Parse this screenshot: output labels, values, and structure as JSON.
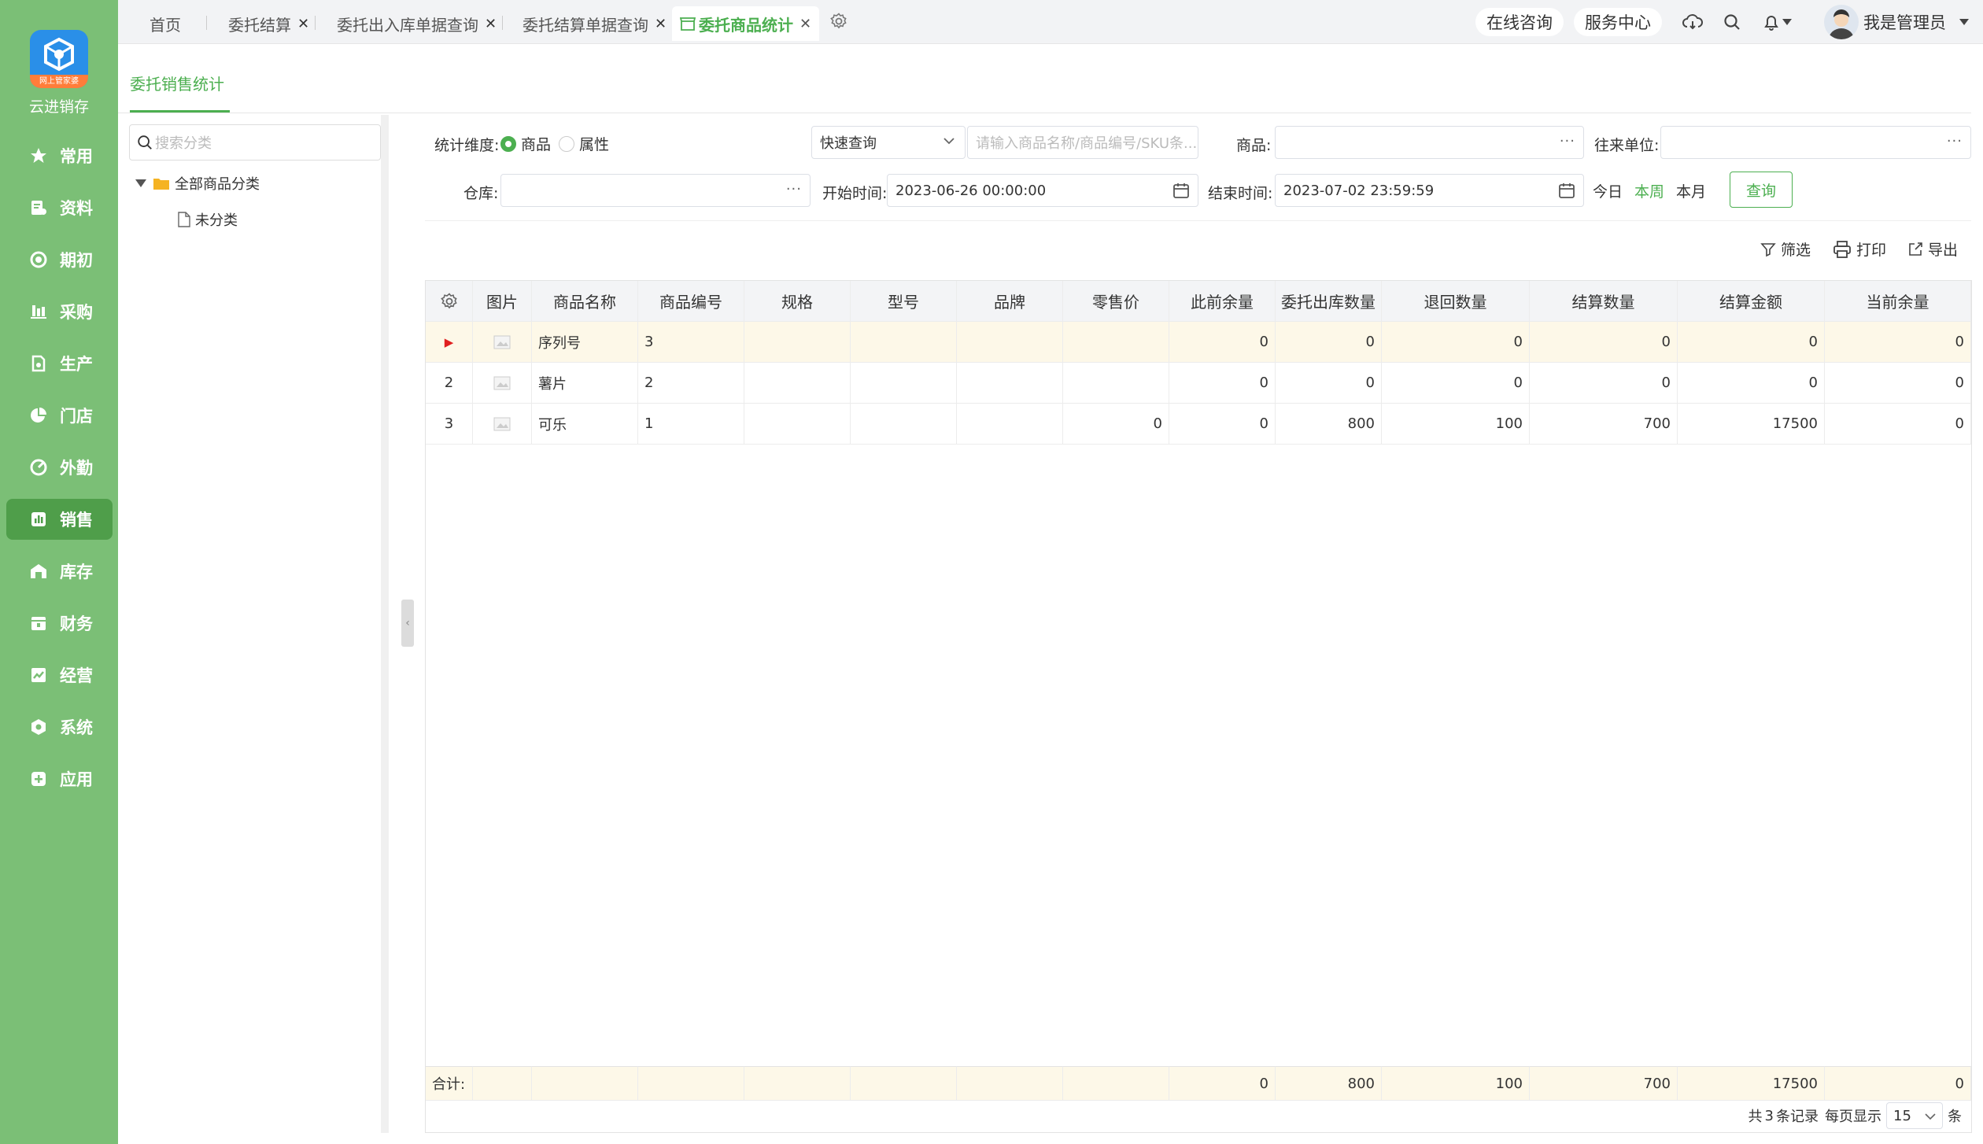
{
  "app": {
    "name": "云进销存",
    "logo_caption": "网上管家婆"
  },
  "sidebar": {
    "items": [
      {
        "label": "常用",
        "icon": "star-icon"
      },
      {
        "label": "资料",
        "icon": "profile-icon"
      },
      {
        "label": "期初",
        "icon": "target-icon"
      },
      {
        "label": "采购",
        "icon": "purchase-icon"
      },
      {
        "label": "生产",
        "icon": "production-icon"
      },
      {
        "label": "门店",
        "icon": "pie-icon"
      },
      {
        "label": "外勤",
        "icon": "field-icon"
      },
      {
        "label": "销售",
        "icon": "bar-chart-icon",
        "active": true
      },
      {
        "label": "库存",
        "icon": "warehouse-icon"
      },
      {
        "label": "财务",
        "icon": "finance-icon"
      },
      {
        "label": "经营",
        "icon": "operation-icon"
      },
      {
        "label": "系统",
        "icon": "hexagon-icon"
      },
      {
        "label": "应用",
        "icon": "plus-square-icon"
      }
    ]
  },
  "tabs": {
    "home": "首页",
    "items": [
      "委托结算",
      "委托出入库单据查询",
      "委托结算单据查询",
      "委托商品统计"
    ],
    "close_glyph": "✕"
  },
  "topbar": {
    "consult": "在线咨询",
    "service": "服务中心",
    "user": "我是管理员"
  },
  "page": {
    "title": "委托销售统计"
  },
  "category": {
    "search_placeholder": "搜索分类",
    "root": "全部商品分类",
    "child": "未分类"
  },
  "filters": {
    "dimension_label": "统计维度:",
    "dim_goods": "商品",
    "dim_attr": "属性",
    "quick_select": "快速查询",
    "quick_placeholder": "请输入商品名称/商品编号/SKU条...",
    "goods_label": "商品:",
    "partner_label": "往来单位:",
    "warehouse_label": "仓库:",
    "start_label": "开始时间:",
    "start_value": "2023-06-26 00:00:00",
    "end_label": "结束时间:",
    "end_value": "2023-07-02 23:59:59",
    "today": "今日",
    "this_week": "本周",
    "this_month": "本月",
    "query": "查询",
    "dots": "···"
  },
  "toolbar": {
    "filter": "筛选",
    "print": "打印",
    "export": "导出"
  },
  "table": {
    "headers": [
      "图片",
      "商品名称",
      "商品编号",
      "规格",
      "型号",
      "品牌",
      "零售价",
      "此前余量",
      "委托出库数量",
      "退回数量",
      "结算数量",
      "结算金额",
      "当前余量"
    ],
    "rows": [
      {
        "idx": "▶",
        "name": "序列号",
        "code": "3",
        "spec": "",
        "model": "",
        "brand": "",
        "price": "",
        "before": "0",
        "out": "0",
        "ret": "0",
        "settle_qty": "0",
        "settle_amt": "0",
        "current": "0"
      },
      {
        "idx": "2",
        "name": "薯片",
        "code": "2",
        "spec": "",
        "model": "",
        "brand": "",
        "price": "",
        "before": "0",
        "out": "0",
        "ret": "0",
        "settle_qty": "0",
        "settle_amt": "0",
        "current": "0"
      },
      {
        "idx": "3",
        "name": "可乐",
        "code": "1",
        "spec": "",
        "model": "",
        "brand": "",
        "price": "0",
        "before": "0",
        "out": "800",
        "ret": "100",
        "settle_qty": "700",
        "settle_amt": "17500",
        "current": "0"
      }
    ],
    "footer": {
      "label": "合计:",
      "before": "0",
      "out": "800",
      "ret": "100",
      "settle_qty": "700",
      "settle_amt": "17500",
      "current": "0"
    }
  },
  "pager": {
    "total_prefix": "共",
    "total": "3",
    "total_suffix": "条记录",
    "per_page_label": "每页显示",
    "per_page": "15",
    "unit": "条"
  }
}
